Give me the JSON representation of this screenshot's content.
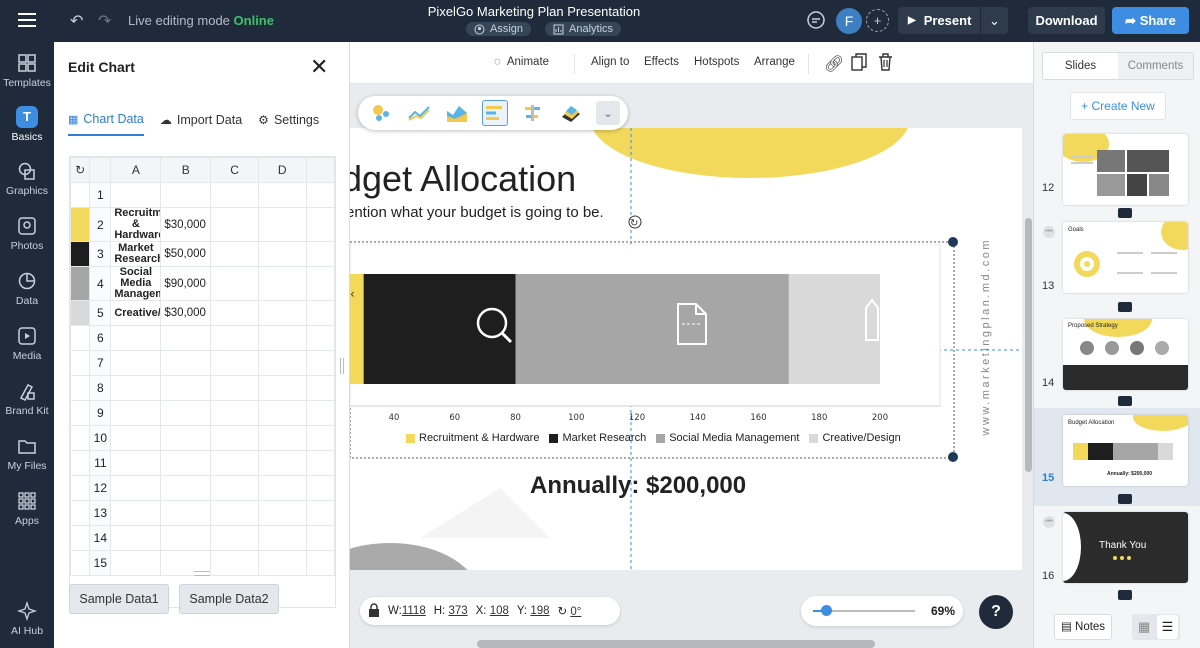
{
  "topbar": {
    "mode_label": "Live editing mode",
    "mode_status": "Online",
    "title": "PixelGo Marketing Plan Presentation",
    "assign": "Assign",
    "analytics": "Analytics",
    "avatar_initial": "F",
    "present": "Present",
    "download": "Download",
    "share": "Share"
  },
  "sidebar": {
    "items": [
      {
        "label": "Templates",
        "icon": "templates-icon"
      },
      {
        "label": "Basics",
        "icon": "basics-icon",
        "glyph": "T"
      },
      {
        "label": "Graphics",
        "icon": "graphics-icon"
      },
      {
        "label": "Photos",
        "icon": "photos-icon"
      },
      {
        "label": "Data",
        "icon": "data-icon"
      },
      {
        "label": "Media",
        "icon": "media-icon"
      },
      {
        "label": "Brand Kit",
        "icon": "brand-kit-icon"
      },
      {
        "label": "My Files",
        "icon": "my-files-icon"
      },
      {
        "label": "Apps",
        "icon": "apps-icon"
      },
      {
        "label": "AI Hub",
        "icon": "ai-hub-icon"
      }
    ]
  },
  "panel": {
    "title": "Edit Chart",
    "tabs": [
      "Chart Data",
      "Import Data",
      "Settings"
    ],
    "columns": [
      "A",
      "B",
      "C",
      "D"
    ],
    "rows": [
      {
        "n": "1",
        "label": "",
        "value": "",
        "color": ""
      },
      {
        "n": "2",
        "label": "Recruitment & Hardware",
        "value": "$30,000",
        "color": "#f2d95c"
      },
      {
        "n": "3",
        "label": "Market Research",
        "value": "$50,000",
        "color": "#1e1e1e"
      },
      {
        "n": "4",
        "label": "Social Media Management",
        "value": "$90,000",
        "color": "#a6a6a6"
      },
      {
        "n": "5",
        "label": "Creative/Design",
        "value": "$30,000",
        "color": "#d9d9d9"
      }
    ],
    "empty_rows": [
      "6",
      "7",
      "8",
      "9",
      "10",
      "11",
      "12",
      "13",
      "14",
      "15"
    ],
    "sample1": "Sample Data1",
    "sample2": "Sample Data2"
  },
  "toolbar": {
    "animate": "Animate",
    "align": "Align to",
    "effects": "Effects",
    "hotspots": "Hotspots",
    "arrange": "Arrange"
  },
  "slide": {
    "title": "dget Allocation",
    "subtitle": "ention what your budget is going to be.",
    "annual": "Annually: $200,000",
    "vertical_text": "www.marketingplan.md.com"
  },
  "chart_data": {
    "type": "bar",
    "orientation": "horizontal-stacked",
    "categories": [
      "Recruitment & Hardware",
      "Market Research",
      "Social Media Management",
      "Creative/Design"
    ],
    "values": [
      30,
      50,
      90,
      30
    ],
    "colors": [
      "#f2d95c",
      "#1e1e1e",
      "#a6a6a6",
      "#d9d9d9"
    ],
    "x_ticks": [
      "40",
      "60",
      "80",
      "100",
      "120",
      "140",
      "160",
      "180",
      "200"
    ],
    "xlim": [
      0,
      200
    ],
    "legend": "bottom"
  },
  "bottombar": {
    "w_label": "W:",
    "w": "1118",
    "h_label": "H:",
    "h": "373",
    "x_label": "X:",
    "x": "108",
    "y_label": "Y:",
    "y": "198",
    "rot": "0°",
    "zoom": "69%",
    "help": "?"
  },
  "right": {
    "tabs": [
      "Slides",
      "Comments"
    ],
    "create_new": "+ Create New",
    "thumbs": [
      {
        "n": "12"
      },
      {
        "n": "13",
        "caption": "Goals"
      },
      {
        "n": "14",
        "caption": "Proposed Strategy"
      },
      {
        "n": "15",
        "caption": "Budget Allocation",
        "thumb_annual": "Annually: $200,000"
      },
      {
        "n": "16",
        "caption": "Thank You"
      }
    ],
    "notes": "Notes"
  }
}
